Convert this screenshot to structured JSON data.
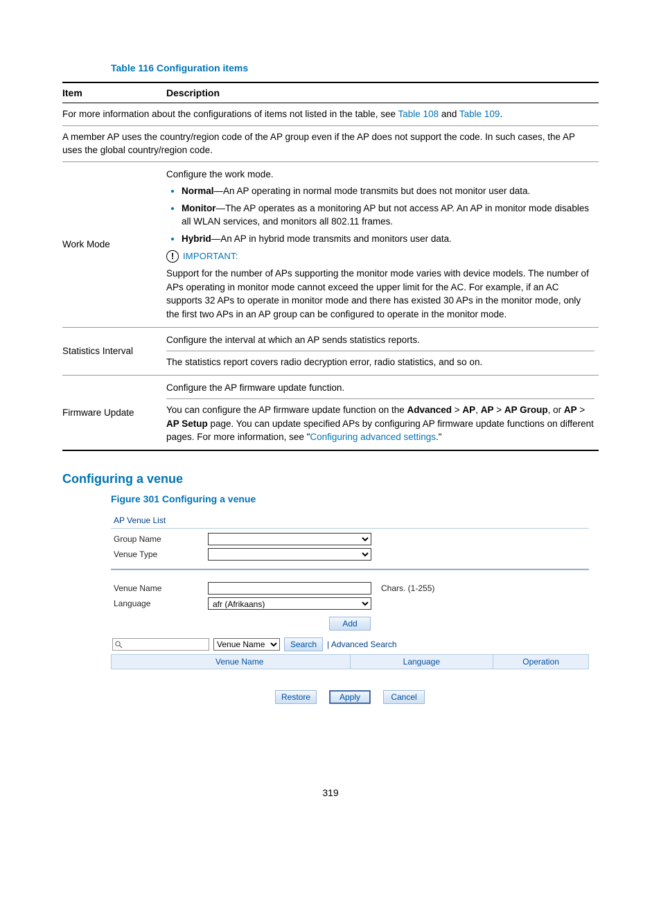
{
  "table_title": "Table 116 Configuration items",
  "headers": {
    "item": "Item",
    "desc": "Description"
  },
  "intro_row": {
    "lead": "For more information about the configurations of items not listed in the table, see ",
    "link1": "Table 108",
    "middle": " and ",
    "link2": "Table 109",
    "trail": "."
  },
  "member_ap_row": "A member AP uses the country/region code of the AP group even if the AP does not support the code. In such cases, the AP uses the global country/region code.",
  "workmode": {
    "label": "Work Mode",
    "line1": "Configure the work mode.",
    "normal_b": "Normal",
    "normal_t": "—An AP operating in normal mode transmits but does not monitor user data.",
    "monitor_b": "Monitor",
    "monitor_t": "—The AP operates as a monitoring AP but not access AP. An AP in monitor mode disables all WLAN services, and monitors all 802.11 frames.",
    "hybrid_b": "Hybrid",
    "hybrid_t": "—An AP in hybrid mode transmits and monitors user data.",
    "important_label": "IMPORTANT:",
    "important_text": "Support for the number of APs supporting the monitor mode varies with device models. The number of APs operating in monitor mode cannot exceed the upper limit for the AC. For example, if an AC supports 32 APs to operate in monitor mode and there has existed 30 APs in the monitor mode, only the first two APs in an AP group can be configured to operate in the monitor mode."
  },
  "statsinterval": {
    "label": "Statistics Interval",
    "line1": "Configure the interval at which an AP sends statistics reports.",
    "line2": "The statistics report covers radio decryption error, radio statistics, and so on."
  },
  "fwupdate": {
    "label": "Firmware Update",
    "line1": "Configure the AP firmware update function.",
    "p1": "You can configure the AP firmware update function on the ",
    "b1": "Advanced",
    "gt": " > ",
    "b2": "AP",
    "sep": ", ",
    "b3": "AP",
    "b4": "AP Group",
    "or": ", or ",
    "b5": "AP",
    "b6": "AP Setup",
    "p2": " page. You can update specified APs by configuring AP firmware update functions on different pages. For more information, see \"",
    "link": "Configuring advanced settings",
    "p3": ".\""
  },
  "heading2": "Configuring a venue",
  "figure_title": "Figure 301 Configuring a venue",
  "figure": {
    "ap_venue_list": "AP Venue List",
    "group_name": "Group Name",
    "venue_type": "Venue Type",
    "venue_name": "Venue Name",
    "language": "Language",
    "language_value": "afr (Afrikaans)",
    "chars_hint": "Chars. (1-255)",
    "add": "Add",
    "search_field": "Venue Name",
    "search_btn": "Search",
    "adv_search": "| Advanced Search",
    "col_venue": "Venue Name",
    "col_lang": "Language",
    "col_op": "Operation",
    "restore": "Restore",
    "apply": "Apply",
    "cancel": "Cancel"
  },
  "page_number": "319"
}
